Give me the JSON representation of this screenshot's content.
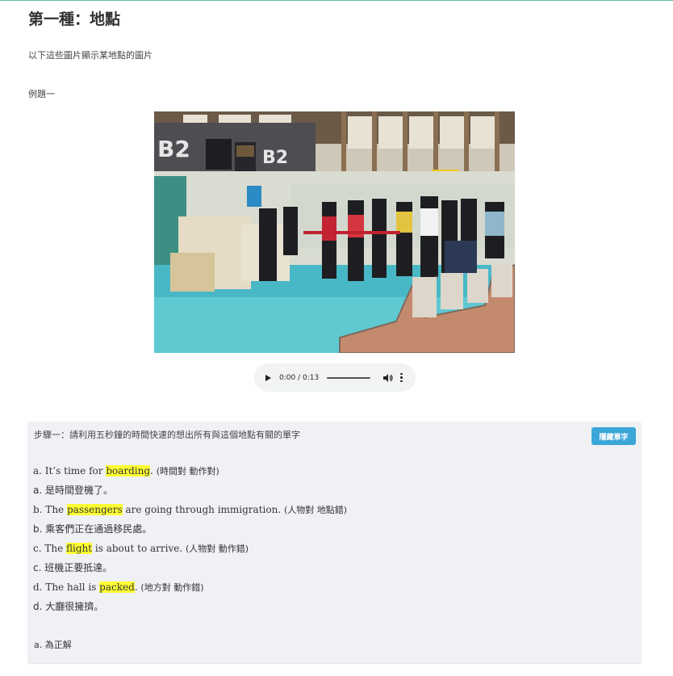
{
  "page": {
    "title": "第一種：地點",
    "subtitle": "以下這些圖片顯示某地點的圖片",
    "example_label": "例題一"
  },
  "audio": {
    "time": "0:00 / 0:13",
    "progress": 0
  },
  "panel": {
    "step_text": "步驟一：請利用五秒鐘的時間快速的想出所有與這個地點有關的單字",
    "hide_button": "隱藏單字",
    "options": [
      {
        "pre": "a. It’s time for ",
        "hl": "boarding",
        "post": ". ",
        "note": "(時間對 動作對)",
        "zh": "a. 是時間登機了。"
      },
      {
        "pre": "b. The ",
        "hl": "passengers",
        "post": " are going through immigration. ",
        "note": "(人物對 地點錯)",
        "zh": "b. 乘客們正在通過移民處。"
      },
      {
        "pre": "c. The ",
        "hl": "flight",
        "post": " is about to arrive. ",
        "note": "(人物對 動作錯)",
        "zh": "c. 班機正要抵達。"
      },
      {
        "pre": "d. The hall is ",
        "hl": "packed",
        "post": ". ",
        "note": "(地方對 動作錯)",
        "zh": "d. 大廳很擁擠。"
      }
    ],
    "answer": "a. 為正解"
  },
  "colors": {
    "accent_button": "#3ba7d9",
    "highlight": "#ffff33",
    "panel_bg": "#eff1f5",
    "top_border": "#5cc0a0"
  },
  "icons": [
    "play-icon",
    "volume-icon",
    "more-vert-icon"
  ]
}
